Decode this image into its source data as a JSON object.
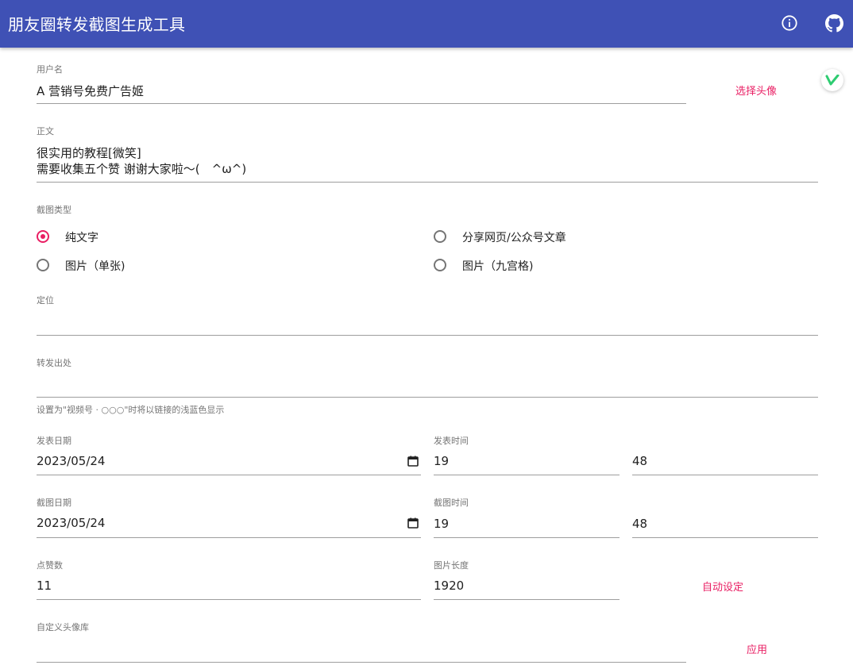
{
  "appbar": {
    "title": "朋友圈转发截图生成工具",
    "info_icon": "info-icon",
    "github_icon": "github-icon"
  },
  "form": {
    "username": {
      "label": "用户名",
      "value": "A 营销号免费广告姬"
    },
    "choose_avatar_label": "选择头像",
    "body": {
      "label": "正文",
      "line1": "很实用的教程[微笑]",
      "line2": "需要收集五个赞 谢谢大家啦～(　^ω^)"
    },
    "screenshot_type": {
      "label": "截图类型",
      "options": [
        {
          "label": "纯文字",
          "checked": true
        },
        {
          "label": "分享网页/公众号文章",
          "checked": false
        },
        {
          "label": "图片（单张)",
          "checked": false
        },
        {
          "label": "图片（九宫格)",
          "checked": false
        }
      ]
    },
    "location": {
      "label": "定位",
      "value": ""
    },
    "forward_source": {
      "label": "转发出处",
      "value": "",
      "helper": "设置为\"视频号 · ○○○\"时将以链接的浅蓝色显示"
    },
    "post_date": {
      "label": "发表日期",
      "value": "2023/05/24"
    },
    "post_time": {
      "label": "发表时间",
      "hour": "19",
      "minute": "48"
    },
    "shot_date": {
      "label": "截图日期",
      "value": "2023/05/24"
    },
    "shot_time": {
      "label": "截图时间",
      "hour": "19",
      "minute": "48"
    },
    "likes": {
      "label": "点赞数",
      "value": "11"
    },
    "image_length": {
      "label": "图片长度",
      "value": "1920"
    },
    "auto_set_label": "自动设定",
    "custom_avatar_lib": {
      "label": "自定义头像库",
      "value": ""
    },
    "apply_label": "应用"
  },
  "colors": {
    "primary": "#3f51b5",
    "accent": "#e91e63"
  }
}
